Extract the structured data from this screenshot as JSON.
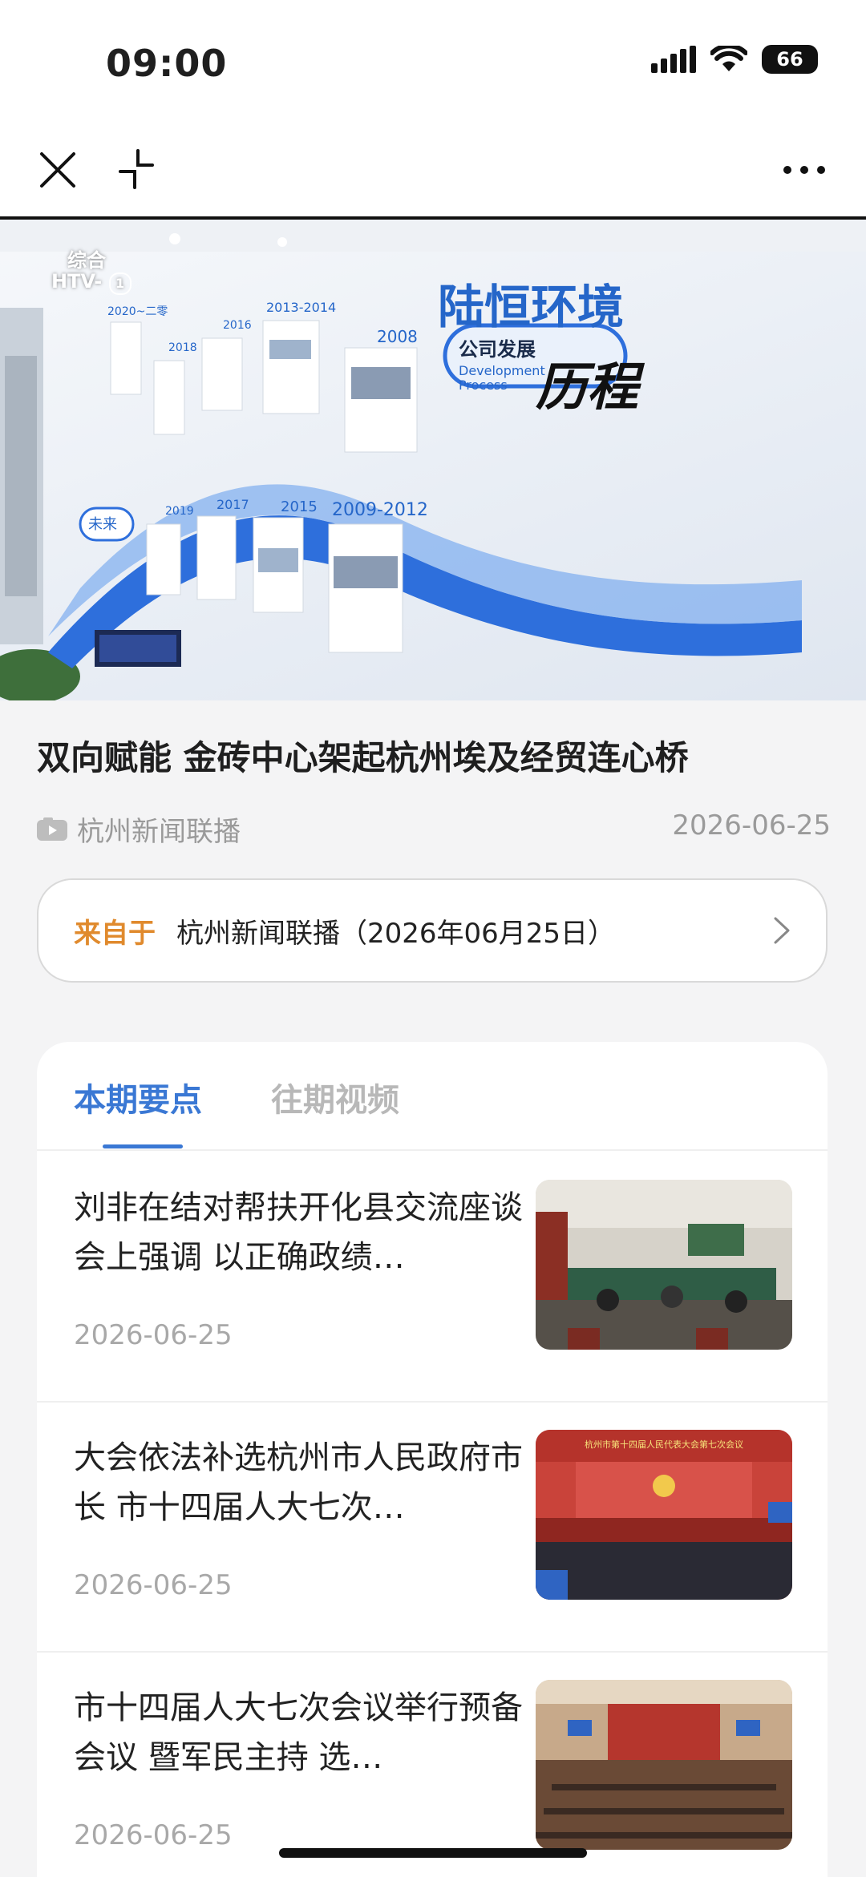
{
  "status_bar": {
    "time": "09:00",
    "battery": "66"
  },
  "hero": {
    "channel_logo_top": "综合",
    "channel_logo_bottom": "HTV-",
    "channel_logo_num": "1",
    "wall_brand": "陆恒环境",
    "wall_caption": "公司发展",
    "wall_english": "Development Process",
    "wall_calligraphy": "历程",
    "years": [
      "2020~二零",
      "2018",
      "2016",
      "2013-2014",
      "2008",
      "2019",
      "2017",
      "2015",
      "2009-2012"
    ],
    "future_label": "未来"
  },
  "article": {
    "title": "双向赋能 金砖中心架起杭州埃及经贸连心桥",
    "channel": "杭州新闻联播",
    "date": "2026-06-25"
  },
  "source": {
    "label": "来自于",
    "text": "杭州新闻联播（2026年06月25日）"
  },
  "tabs": [
    {
      "label": "本期要点"
    },
    {
      "label": "往期视频"
    }
  ],
  "items": [
    {
      "title": "刘非在结对帮扶开化县交流座谈会上强调 以正确政绩…",
      "date": "2026-06-25"
    },
    {
      "title": "大会依法补选杭州市人民政府市长 市十四届人大七次…",
      "date": "2026-06-25"
    },
    {
      "title": "市十四届人大七次会议举行预备会议 暨军民主持 选…",
      "date": "2026-06-25"
    }
  ],
  "thumb_banner": "杭州市第十四届人民代表大会第七次会议"
}
